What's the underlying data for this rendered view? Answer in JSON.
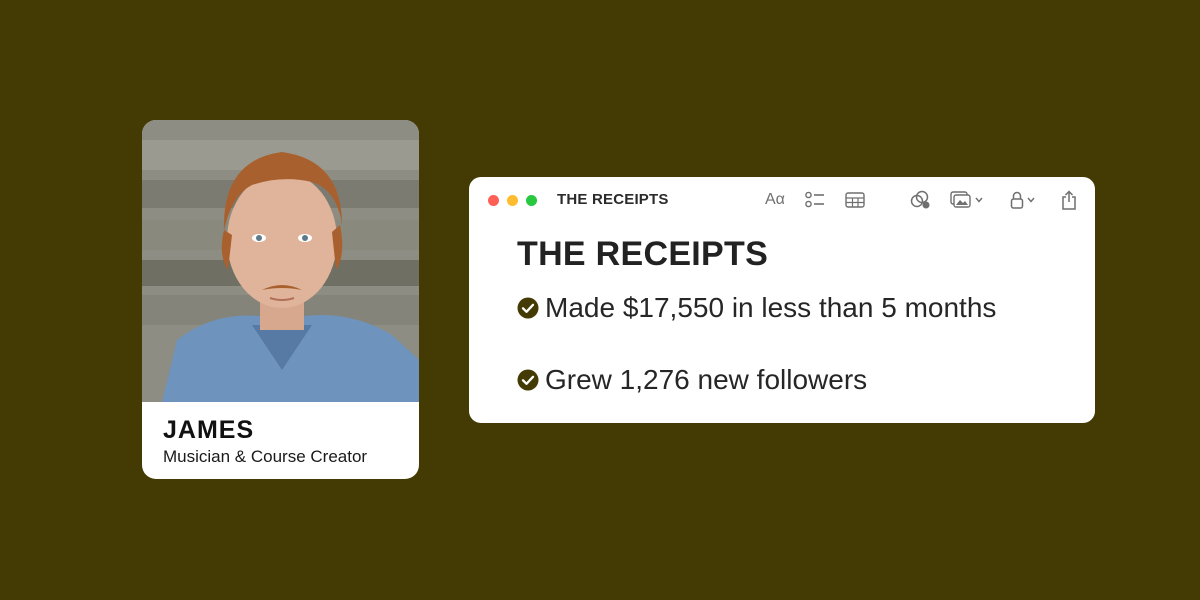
{
  "profile": {
    "name": "JAMES",
    "role": "Musician & Course Creator"
  },
  "notes_window": {
    "title": "THE RECEIPTS",
    "toolbar": {
      "format_label": "Aα",
      "icons": [
        "checklist-icon",
        "table-icon",
        "collaborate-icon",
        "media-icon",
        "lock-icon",
        "share-icon"
      ]
    },
    "heading": "THE RECEIPTS",
    "checklist": [
      {
        "text": "Made $17,550 in less than 5 months",
        "checked": true
      },
      {
        "text": "Grew 1,276 new followers",
        "checked": true
      }
    ]
  },
  "colors": {
    "background": "#433b03",
    "check": "#433b03",
    "traffic_close": "#fe5f57",
    "traffic_minimize": "#febc2e",
    "traffic_maximize": "#28c840"
  }
}
